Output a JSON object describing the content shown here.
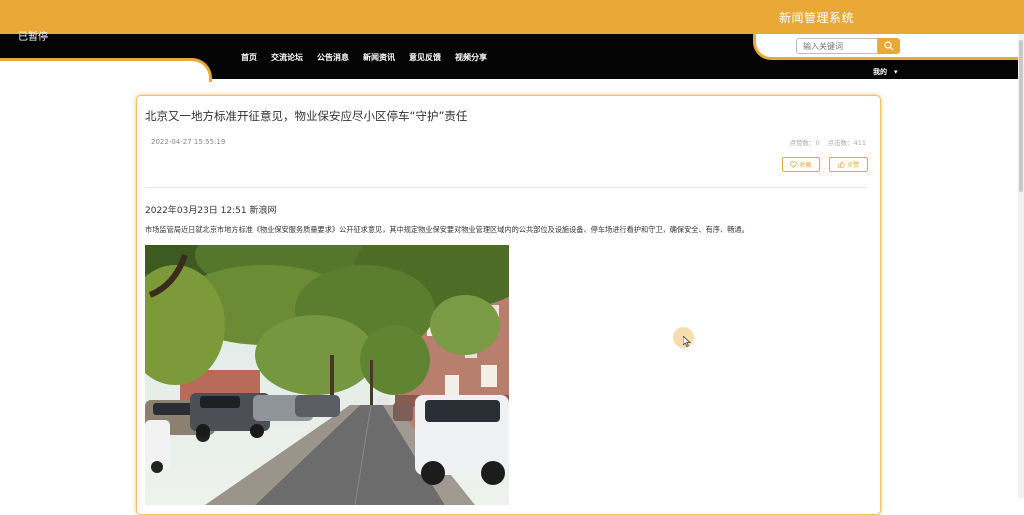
{
  "header": {
    "system_title": "新闻管理系统",
    "paused_label": "已暂停",
    "search": {
      "placeholder": "输入关键词"
    },
    "nav": [
      "首页",
      "交流论坛",
      "公告消息",
      "新闻资讯",
      "意见反馈",
      "视频分享"
    ],
    "user_menu_label": "我的"
  },
  "article": {
    "title": "北京又一地方标准开征意见，物业保安应尽小区停车“守护”责任",
    "datetime": "2022-04-27 15:55:19",
    "like_count_label": "点赞数：0",
    "click_count_label": "点击数：411",
    "collect_label": "收藏",
    "like_label": "点赞",
    "source_line": "2022年03月23日 12:51 新浪网",
    "paragraph": "市场监管局近日就北京市地方标准《物业保安服务质量要求》公开征求意见，其中规定物业保安要对物业管理区域内的公共部位及设施设备、停车场进行看护和守卫，确保安全、有序、畅通。"
  },
  "colors": {
    "accent": "#eaa936",
    "nav_background": "#050505",
    "card_border": "#f0c060"
  },
  "icons": [
    "search-icon",
    "heart-icon",
    "thumbs-up-icon",
    "chevron-down-icon",
    "mouse-cursor-icon"
  ]
}
